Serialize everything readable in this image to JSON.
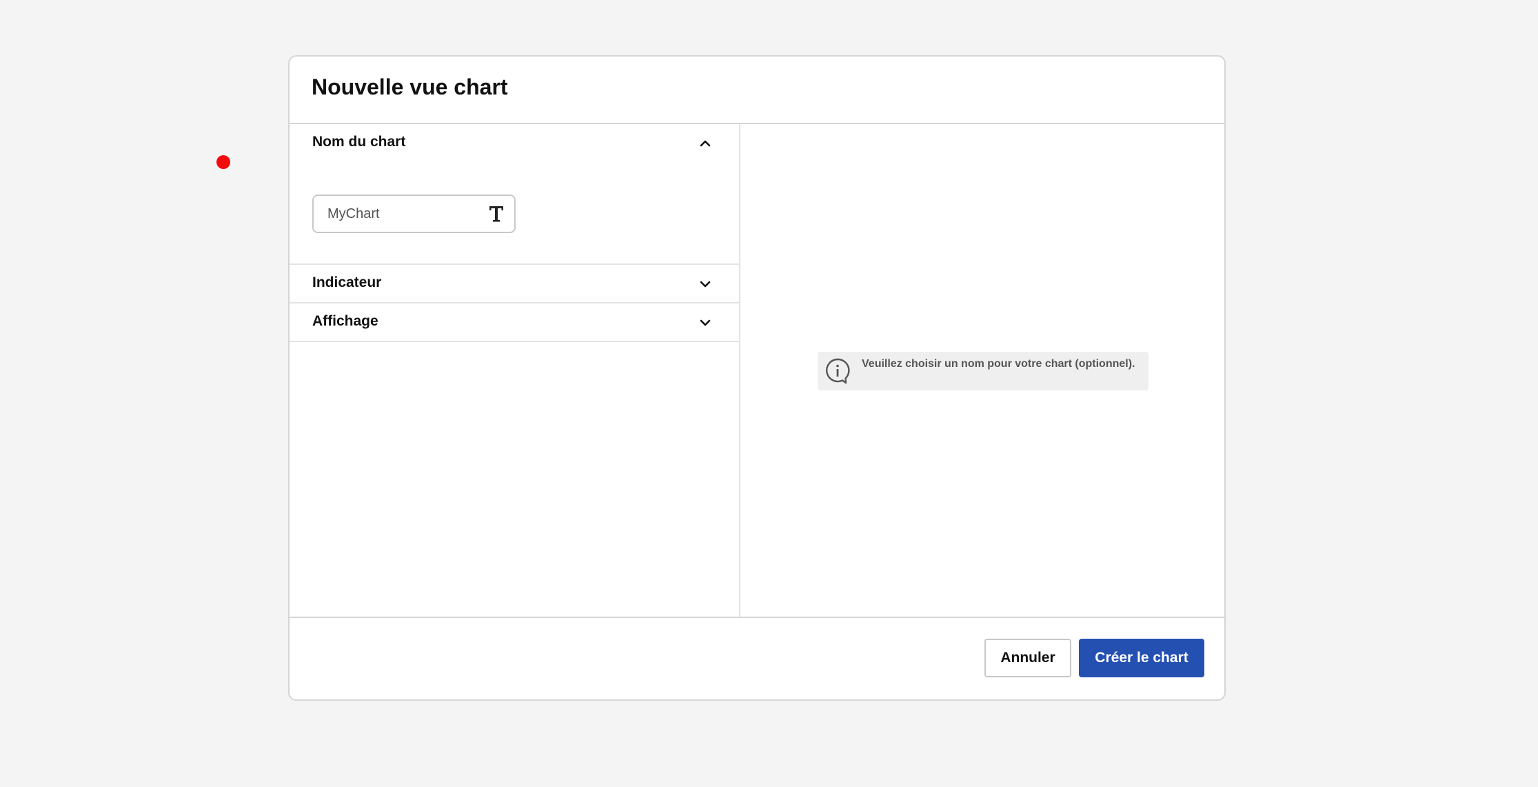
{
  "dialog": {
    "title": "Nouvelle vue chart"
  },
  "sections": {
    "name": {
      "label": "Nom du chart",
      "expanded": true,
      "chevron_icon": "chevron-up-icon",
      "input": {
        "value": "MyChart",
        "type_icon": "text-type-icon",
        "required_indicator_color": "#f20c0c"
      }
    },
    "indicator": {
      "label": "Indicateur",
      "expanded": false,
      "chevron_icon": "chevron-down-icon"
    },
    "display": {
      "label": "Affichage",
      "expanded": false,
      "chevron_icon": "chevron-down-icon"
    }
  },
  "info": {
    "icon": "info-icon",
    "text": "Veuillez choisir un nom pour votre chart (optionnel)."
  },
  "footer": {
    "cancel_label": "Annuler",
    "create_label": "Créer le chart"
  },
  "colors": {
    "primary": "#2450b2",
    "background": "#f4f4f4",
    "required": "#f20c0c"
  }
}
